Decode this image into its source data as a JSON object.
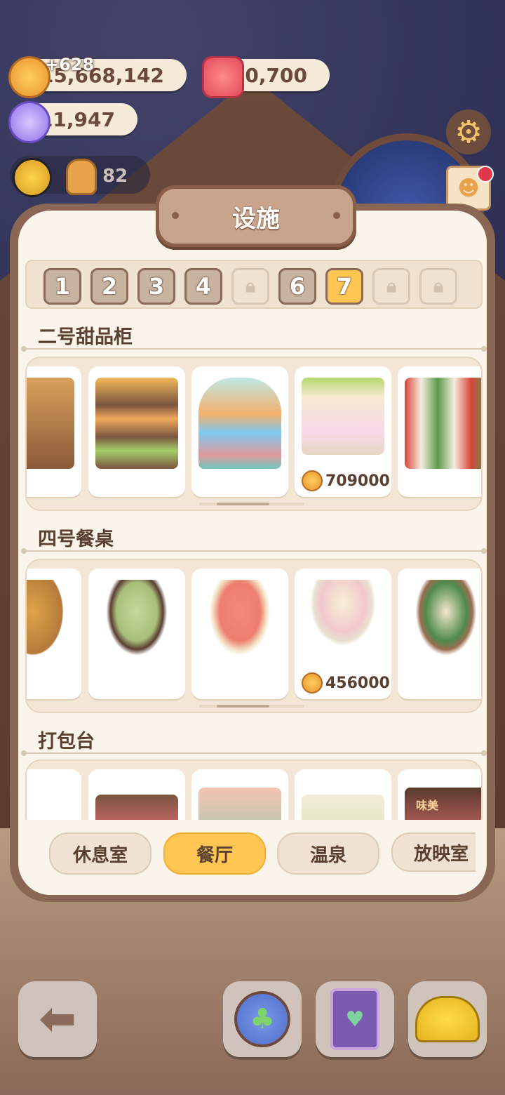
{
  "resources": {
    "coins": "15,668,142",
    "coins_gain": "+628",
    "candles": "10,700",
    "candy": "11,947",
    "level": "82"
  },
  "panel": {
    "title": "设施",
    "pages": [
      {
        "label": "1",
        "state": "normal"
      },
      {
        "label": "2",
        "state": "normal"
      },
      {
        "label": "3",
        "state": "normal"
      },
      {
        "label": "4",
        "state": "normal"
      },
      {
        "label": "",
        "state": "locked"
      },
      {
        "label": "6",
        "state": "normal"
      },
      {
        "label": "7",
        "state": "active"
      },
      {
        "label": "",
        "state": "locked"
      },
      {
        "label": "",
        "state": "locked"
      }
    ],
    "sections": [
      {
        "title": "二号甜品柜",
        "items": [
          {
            "name": "dessert-cabinet-1",
            "price": ""
          },
          {
            "name": "dessert-cabinet-2",
            "price": ""
          },
          {
            "name": "dessert-cabinet-3",
            "price": ""
          },
          {
            "name": "dessert-cabinet-4",
            "price": "709000"
          },
          {
            "name": "dessert-cabinet-5",
            "price": ""
          }
        ]
      },
      {
        "title": "四号餐桌",
        "items": [
          {
            "name": "dining-table-1",
            "price": ""
          },
          {
            "name": "dining-table-2",
            "price": ""
          },
          {
            "name": "dining-table-3",
            "price": ""
          },
          {
            "name": "dining-table-4",
            "price": "456000"
          },
          {
            "name": "dining-table-5",
            "price": ""
          }
        ]
      },
      {
        "title": "打包台",
        "items": [
          {
            "name": "packing-table-1",
            "price": ""
          },
          {
            "name": "packing-table-2",
            "price": ""
          },
          {
            "name": "packing-table-3",
            "price": ""
          },
          {
            "name": "packing-table-4",
            "price": ""
          },
          {
            "name": "packing-table-5",
            "price": "",
            "sign": "味美"
          }
        ]
      }
    ],
    "categories": [
      {
        "label": "休息室",
        "active": false
      },
      {
        "label": "餐厅",
        "active": true
      },
      {
        "label": "温泉",
        "active": false
      },
      {
        "label": "放映室",
        "active": false
      }
    ]
  },
  "colors": {
    "accent": "#ffc653",
    "panel_bg": "#fbf4ea",
    "text_brown": "#5a4030",
    "frame_brown": "#8a6754"
  },
  "icons": [
    "coin-icon",
    "candle-icon",
    "candy-icon",
    "sun-icon",
    "gear-icon",
    "back-arrow-icon",
    "clover-icon",
    "card-icon",
    "hat-icon",
    "lock-icon"
  ]
}
